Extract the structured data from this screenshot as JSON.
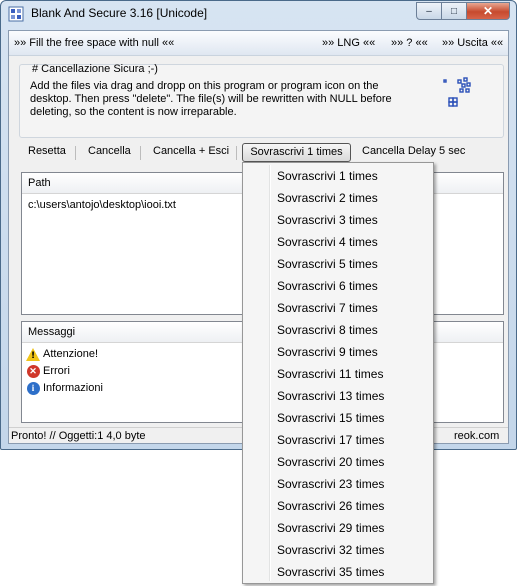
{
  "window": {
    "title": "Blank And Secure 3.16 [Unicode]",
    "min_glyph": "–",
    "max_glyph": "□",
    "close_glyph": "✕"
  },
  "menu": {
    "fill": "»» Fill the free space with null ««",
    "lng": "»» LNG ««",
    "help": "»» ? ««",
    "exit": "»» Uscita ««"
  },
  "group": {
    "title": "# Cancellazione Sicura ;-)",
    "text": "Add the files via drag and dropp on this program or program icon on the desktop. Then press \"delete\". The file(s) will be rewritten with NULL before deleting, so the content is now irreparable."
  },
  "toolbar": {
    "reset": "Resetta",
    "delete": "Cancella",
    "delete_exit": "Cancella + Esci",
    "overwrite": "Sovrascrivi 1 times",
    "delay": "Cancella Delay 5 sec"
  },
  "files": {
    "column": "Path",
    "rows": [
      "c:\\users\\antojo\\desktop\\iooi.txt"
    ]
  },
  "messages": {
    "column": "Messaggi",
    "items": [
      {
        "label": "Attenzione!",
        "icon": "warning-icon"
      },
      {
        "label": "Errori",
        "icon": "error-icon"
      },
      {
        "label": "Informazioni",
        "icon": "info-icon"
      }
    ]
  },
  "status": {
    "left": "Pronto! // Oggetti:1 4,0 byte",
    "right": "reok.com"
  },
  "dropdown": {
    "items": [
      "Sovrascrivi 1 times",
      "Sovrascrivi 2 times",
      "Sovrascrivi 3 times",
      "Sovrascrivi 4 times",
      "Sovrascrivi 5 times",
      "Sovrascrivi 6 times",
      "Sovrascrivi 7 times",
      "Sovrascrivi 8 times",
      "Sovrascrivi 9 times",
      "Sovrascrivi 11 times",
      "Sovrascrivi 13 times",
      "Sovrascrivi 15 times",
      "Sovrascrivi 17 times",
      "Sovrascrivi 20 times",
      "Sovrascrivi 23 times",
      "Sovrascrivi 26 times",
      "Sovrascrivi 29 times",
      "Sovrascrivi 32 times",
      "Sovrascrivi 35 times"
    ]
  },
  "colors": {
    "title_gradient_top": "#d7e4f2",
    "client_bg": "#f0f0f0",
    "close_button": "#c74a2e"
  }
}
